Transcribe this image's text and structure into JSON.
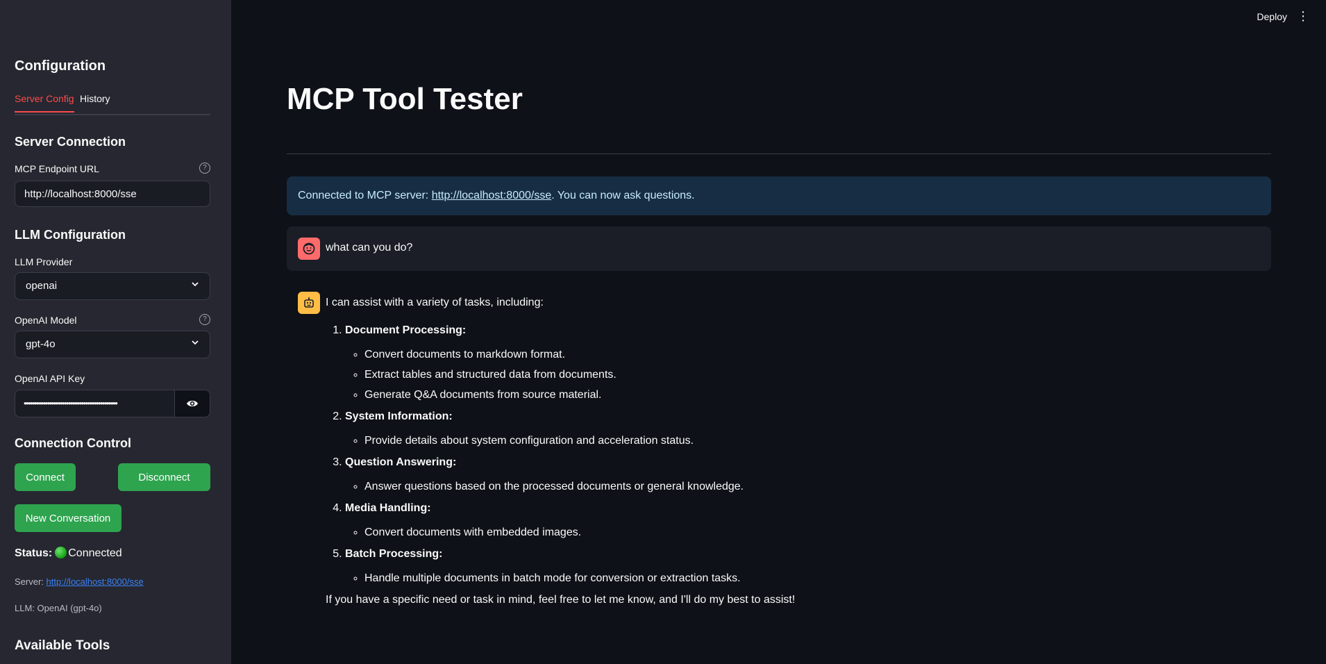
{
  "topbar": {
    "deploy_label": "Deploy",
    "menu_icon": "more-vertical-icon"
  },
  "sidebar": {
    "title": "Configuration",
    "tabs": [
      {
        "label": "Server Config",
        "active": true
      },
      {
        "label": "History",
        "active": false
      }
    ],
    "server_connection": {
      "title": "Server Connection",
      "endpoint_label": "MCP Endpoint URL",
      "endpoint_value": "http://localhost:8000/sse"
    },
    "llm_config": {
      "title": "LLM Configuration",
      "provider_label": "LLM Provider",
      "provider_value": "openai",
      "model_label": "OpenAI Model",
      "model_value": "gpt-4o",
      "api_key_label": "OpenAI API Key",
      "api_key_masked": "••••••••••••••••••••••••••••••••••••••••••••"
    },
    "connection_control": {
      "title": "Connection Control",
      "connect_label": "Connect",
      "disconnect_label": "Disconnect",
      "new_conversation_label": "New Conversation"
    },
    "status": {
      "label": "Status:",
      "value": "Connected",
      "server_label": "Server:",
      "server_url": "http://localhost:8000/sse",
      "llm_text": "LLM: OpenAI (gpt-4o)"
    },
    "available_tools_title": "Available Tools"
  },
  "main": {
    "title": "MCP Tool Tester",
    "info_prefix": "Connected to MCP server: ",
    "info_link": "http://localhost:8000/sse",
    "info_suffix": ". You can now ask questions.",
    "user_message": "what can you do?",
    "bot_intro": "I can assist with a variety of tasks, including:",
    "bot_items": [
      {
        "title": "Document Processing:",
        "subs": [
          "Convert documents to markdown format.",
          "Extract tables and structured data from documents.",
          "Generate Q&A documents from source material."
        ]
      },
      {
        "title": "System Information:",
        "subs": [
          "Provide details about system configuration and acceleration status."
        ]
      },
      {
        "title": "Question Answering:",
        "subs": [
          "Answer questions based on the processed documents or general knowledge."
        ]
      },
      {
        "title": "Media Handling:",
        "subs": [
          "Convert documents with embedded images."
        ]
      },
      {
        "title": "Batch Processing:",
        "subs": [
          "Handle multiple documents in batch mode for conversion or extraction tasks."
        ]
      }
    ],
    "bot_closing": "If you have a specific need or task in mind, feel free to let me know, and I'll do my best to assist!"
  },
  "colors": {
    "accent": "#ff4b4b",
    "button_green": "#2ea44f",
    "info_bg": "#172d43",
    "user_avatar": "#ff6b6b",
    "bot_avatar": "#ffbd45"
  }
}
